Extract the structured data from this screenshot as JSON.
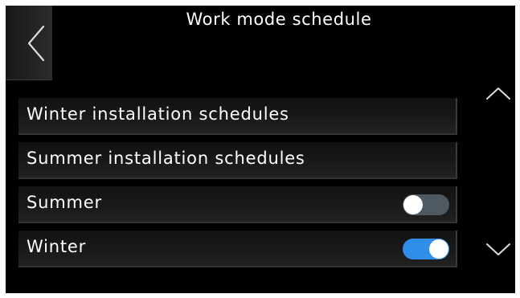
{
  "header": {
    "title": "Work mode schedule",
    "back_icon": "chevron-left-icon"
  },
  "rows": [
    {
      "label": "Winter installation schedules"
    },
    {
      "label": "Summer installation schedules"
    },
    {
      "label": "Summer",
      "toggle": "off"
    },
    {
      "label": "Winter",
      "toggle": "on"
    }
  ],
  "scroll": {
    "up_icon": "chevron-up-icon",
    "down_icon": "chevron-down-icon"
  },
  "colors": {
    "background": "#000000",
    "toggle_on": "#2f8fe8",
    "toggle_off": "#4f5962",
    "text": "#ffffff"
  }
}
